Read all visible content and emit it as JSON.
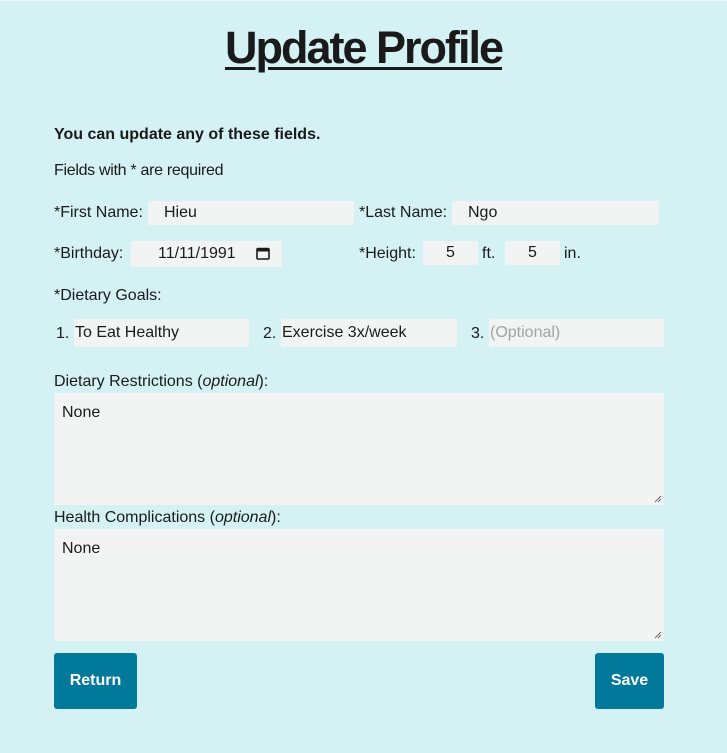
{
  "page": {
    "title": "Update Profile",
    "intro": "You can update any of these fields.",
    "required_note": "Fields with * are required"
  },
  "name": {
    "first_label": "*First Name:",
    "first_value": "Hieu",
    "last_label": "*Last Name:",
    "last_value": "Ngo"
  },
  "birthday": {
    "label": "*Birthday:",
    "value": "11/11/1991",
    "icon": "calendar-icon"
  },
  "height": {
    "label": "*Height:",
    "feet_value": "5",
    "feet_unit": "ft.",
    "inches_value": "5",
    "inches_unit": "in."
  },
  "goals": {
    "label": "*Dietary Goals:",
    "items": [
      {
        "number": "1.",
        "value": "To Eat Healthy",
        "placeholder": ""
      },
      {
        "number": "2.",
        "value": "Exercise 3x/week",
        "placeholder": ""
      },
      {
        "number": "3.",
        "value": "",
        "placeholder": "(Optional)"
      }
    ]
  },
  "restrictions": {
    "label_prefix": "Dietary Restrictions (",
    "label_optional": "optional",
    "label_suffix": "):",
    "value": "None"
  },
  "complications": {
    "label_prefix": "Health Complications (",
    "label_optional": "optional",
    "label_suffix": "):",
    "value": "None"
  },
  "actions": {
    "return_label": "Return",
    "save_label": "Save"
  },
  "colors": {
    "background": "#d4f1f4",
    "input_bg": "#f2f4f3",
    "button": "#00799b"
  }
}
